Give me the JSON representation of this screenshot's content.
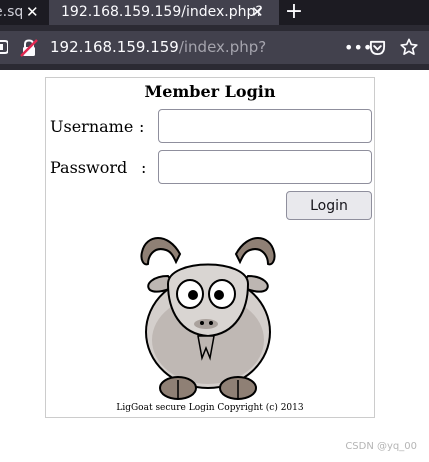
{
  "tabs": {
    "previous_tab": {
      "title": "e.sq",
      "close": "✕"
    },
    "active_tab": {
      "title": "192.168.159.159/index.php?",
      "close": "✕"
    },
    "new_tab": "+"
  },
  "urlbar": {
    "host": "192.168.159.159",
    "path": "/index.php?",
    "menu": "•••"
  },
  "login": {
    "title": "Member Login",
    "username_label": "Username",
    "username_colon": ":",
    "username_value": "",
    "password_label": "Password",
    "password_colon": ":",
    "password_value": "",
    "button_label": "Login",
    "copyright": "LigGoat secure Login Copyright (c) 2013"
  },
  "watermark": "CSDN @yq_00",
  "colors": {
    "tab_strip": "#1c1b22",
    "active_tab": "#42414d",
    "toolbar": "#2b2a33",
    "insecure_red": "#e22850"
  }
}
